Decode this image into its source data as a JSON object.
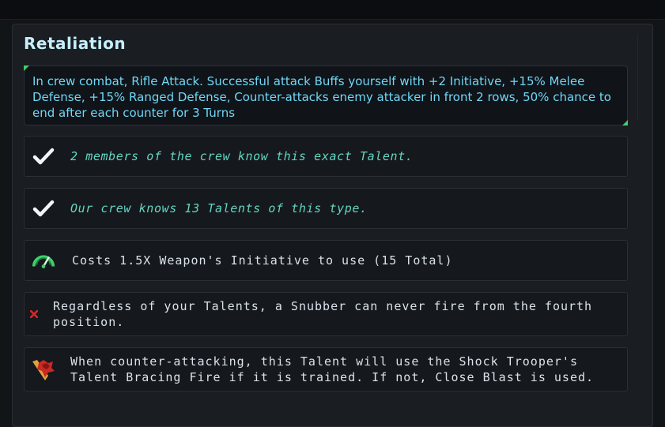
{
  "talent": {
    "title": "Retaliation",
    "description": "In crew combat, Rifle Attack. Successful attack Buffs yourself with +2 Initiative, +15% Melee Defense, +15% Ranged Defense, Counter-attacks enemy attacker in front 2 rows, 50% chance to end after each counter for 3 Turns"
  },
  "rows": [
    {
      "icon": "checkmark-icon",
      "text": "2 members of the crew know this exact Talent."
    },
    {
      "icon": "checkmark-icon",
      "text": "Our crew knows 13 Talents of this type."
    },
    {
      "icon": "initiative-gauge-icon",
      "text": "Costs 1.5X Weapon's Initiative to use (15 Total)"
    },
    {
      "icon": "red-x-icon",
      "text": "Regardless of your Talents, a Snubber can never fire from the fourth position."
    },
    {
      "icon": "shock-trooper-icon",
      "text": "When counter-attacking, this Talent will use the Shock Trooper's Talent Bracing Fire if it is trained. If not, Close Blast is used."
    }
  ],
  "colors": {
    "title": "#c6efff",
    "description": "#6fd8f6",
    "known_text": "#62d6c3",
    "info_text": "#d9e2ea",
    "accent_green": "#3fd06a",
    "error_red": "#d9262a"
  }
}
